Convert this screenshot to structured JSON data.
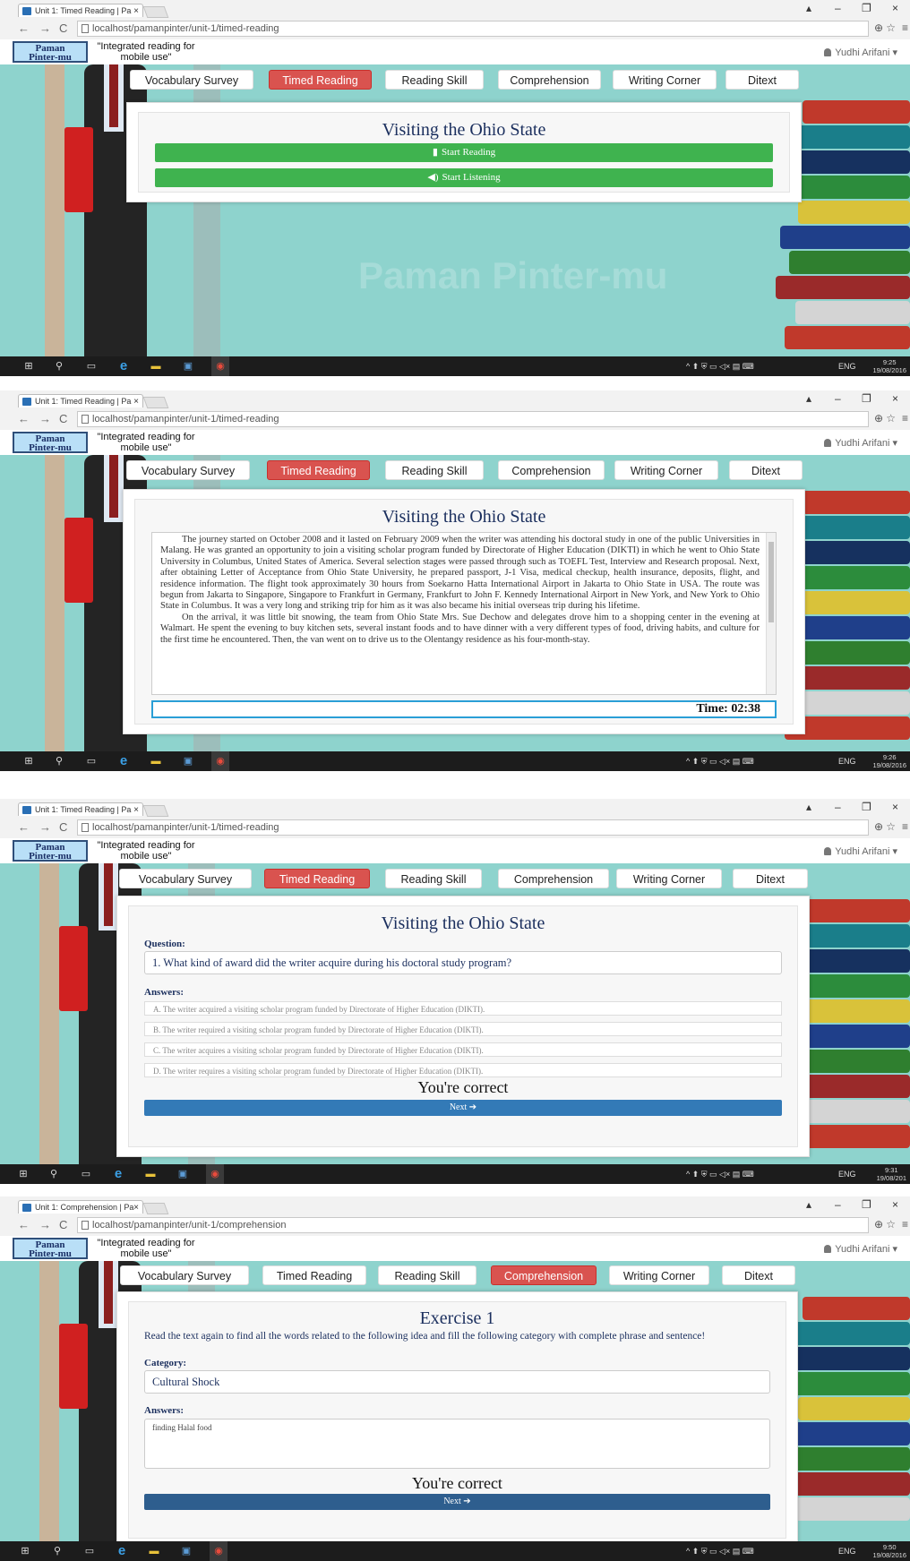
{
  "browser": {
    "tab_close": "×",
    "win_minimize": "–",
    "win_restore": "❐",
    "win_close": "×",
    "nav_back": "←",
    "nav_forward": "→",
    "nav_reload": "C",
    "zoom_icon": "⊕",
    "star_icon": "☆",
    "menu_icon": "≡"
  },
  "site": {
    "logo_line1": "Paman",
    "logo_line2": "Pinter-mu",
    "tagline": "\"Integrated reading for mobile use\"",
    "user": "Yudhi Arifani ▾",
    "menu": [
      "Vocabulary Survey",
      "Timed Reading",
      "Reading Skill",
      "Comprehension",
      "Writing Corner",
      "Ditext"
    ],
    "watermark": "Paman Pinter-mu"
  },
  "screens": [
    {
      "tab_title": "Unit 1: Timed Reading | Pa",
      "url": "localhost/pamanpinter/unit-1/timed-reading",
      "title": "Visiting the Ohio State",
      "start_reading": "Start Reading",
      "start_listening": "Start Listening",
      "clock_time": "9:25",
      "clock_date": "19/08/2016"
    },
    {
      "tab_title": "Unit 1: Timed Reading | Pa",
      "url": "localhost/pamanpinter/unit-1/timed-reading",
      "title": "Visiting the Ohio State",
      "paragraph1": "The journey started on October 2008 and it lasted on February 2009 when the writer was attending his doctoral study in one of the public Universities in Malang. He was granted an opportunity to join a visiting scholar program funded by Directorate of Higher Education (DIKTI) in which he went to Ohio State University in Columbus, United States of America. Several selection stages were passed through such as TOEFL Test, Interview and Research proposal. Next, after obtaining Letter of Acceptance from Ohio State University, he prepared passport, J-1 Visa, medical checkup, health insurance, deposits, flight, and residence information. The flight took approximately 30 hours from Soekarno Hatta International Airport in Jakarta to Ohio State in USA. The route was begun from Jakarta to Singapore, Singapore to Frankfurt in Germany, Frankfurt to John F. Kennedy International Airport in New York, and New York to Ohio State in Columbus. It was a very long and striking trip for him as it was also became his initial overseas trip during his lifetime.",
      "paragraph2": "On the arrival, it was little bit snowing, the team from Ohio State Mrs. Sue Dechow and delegates drove him to a shopping center in the evening at Walmart. He spent the evening to buy kitchen sets, several instant foods and to have dinner with a very different types of food, driving habits, and culture for the first time he encountered. Then, the van went on to drive us to the Olentangy residence as his four-month-stay.",
      "timer": "Time: 02:38",
      "clock_time": "9:26",
      "clock_date": "19/08/2016"
    },
    {
      "tab_title": "Unit 1: Timed Reading | Pa",
      "url": "localhost/pamanpinter/unit-1/timed-reading",
      "title": "Visiting the Ohio State",
      "question_label": "Question:",
      "question": "1. What kind of award did the writer acquire during his doctoral study program?",
      "answers_label": "Answers:",
      "answers": [
        "A. The writer acquired a visiting scholar program funded by Directorate of Higher Education (DIKTI).",
        "B. The writer required a visiting scholar program funded by Directorate of Higher Education (DIKTI).",
        "C. The writer acquires a visiting scholar program funded by Directorate of Higher Education (DIKTI).",
        "D. The writer requires a visiting scholar program funded by Directorate of Higher Education (DIKTI)."
      ],
      "feedback": "You're correct",
      "next": "Next ➔",
      "clock_time": "9:31",
      "clock_date": "19/08/201"
    },
    {
      "tab_title": "Unit 1: Comprehension | Pa",
      "url": "localhost/pamanpinter/unit-1/comprehension",
      "title": "Exercise 1",
      "instruction": "Read the text again to find all the words related to the following idea and fill the following category with complete phrase and sentence!",
      "category_label": "Category:",
      "category": "Cultural Shock",
      "answers_label": "Answers:",
      "answer": "finding Halal food",
      "feedback": "You're correct",
      "next": "Next ➔",
      "clock_time": "9:50",
      "clock_date": "19/08/2016"
    }
  ],
  "taskbar": {
    "start": "⊞",
    "search": "⚲",
    "taskview": "▭",
    "edge": "e",
    "explorer": "▬",
    "store": "▣",
    "chrome": "◉",
    "tray_icons": "^  ⬆  ⛨  ▭  ◁×  ▤  ⌨",
    "lang": "ENG"
  },
  "colors": {
    "teal": "#8ed3cd",
    "active_menu": "#d9534f",
    "green_btn": "#3fb34f",
    "next_btn": "#337ab7",
    "title": "#1b2f5e"
  }
}
